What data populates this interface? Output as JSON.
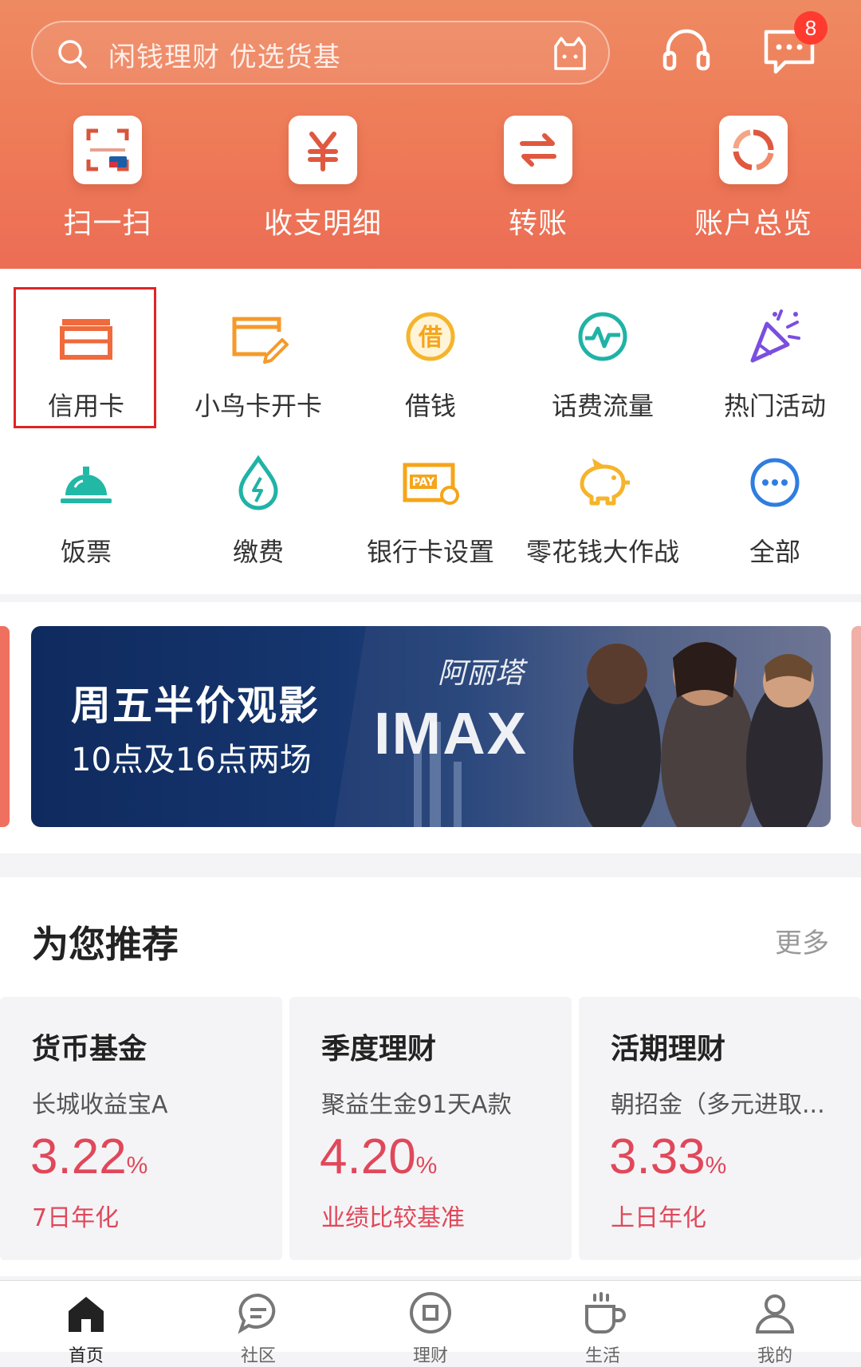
{
  "header": {
    "search_placeholder": "闲钱理财 优选货基",
    "message_badge": "8",
    "quick_actions": [
      {
        "label": "扫一扫",
        "icon": "scan-icon"
      },
      {
        "label": "收支明细",
        "icon": "yuan-icon"
      },
      {
        "label": "转账",
        "icon": "transfer-icon"
      },
      {
        "label": "账户总览",
        "icon": "account-overview-icon"
      }
    ]
  },
  "services": [
    {
      "label": "信用卡",
      "icon": "credit-card-icon"
    },
    {
      "label": "小鸟卡开卡",
      "icon": "card-edit-icon"
    },
    {
      "label": "借钱",
      "icon": "borrow-icon"
    },
    {
      "label": "话费流量",
      "icon": "phone-data-icon"
    },
    {
      "label": "热门活动",
      "icon": "party-popper-icon"
    },
    {
      "label": "饭票",
      "icon": "meal-bell-icon"
    },
    {
      "label": "缴费",
      "icon": "utility-drop-icon"
    },
    {
      "label": "银行卡设置",
      "icon": "pay-settings-icon"
    },
    {
      "label": "零花钱大作战",
      "icon": "piggy-bank-icon"
    },
    {
      "label": "全部",
      "icon": "more-dots-icon"
    }
  ],
  "banner": {
    "title": "周五半价观影",
    "subtitle": "10点及16点两场",
    "brand": "IMAX",
    "film": "阿丽塔"
  },
  "recommend": {
    "title": "为您推荐",
    "more": "更多",
    "cards": [
      {
        "category": "货币基金",
        "product": "长城收益宝A",
        "rate": "3.22",
        "unit": "%",
        "rate_label": "7日年化"
      },
      {
        "category": "季度理财",
        "product": "聚益生金91天A款",
        "rate": "4.20",
        "unit": "%",
        "rate_label": "业绩比较基准"
      },
      {
        "category": "活期理财",
        "product": "朝招金（多元进取...",
        "rate": "3.33",
        "unit": "%",
        "rate_label": "上日年化"
      }
    ]
  },
  "tabbar": [
    {
      "label": "首页",
      "icon": "home-icon"
    },
    {
      "label": "社区",
      "icon": "community-icon"
    },
    {
      "label": "理财",
      "icon": "wealth-icon"
    },
    {
      "label": "生活",
      "icon": "coffee-icon"
    },
    {
      "label": "我的",
      "icon": "profile-icon"
    }
  ]
}
